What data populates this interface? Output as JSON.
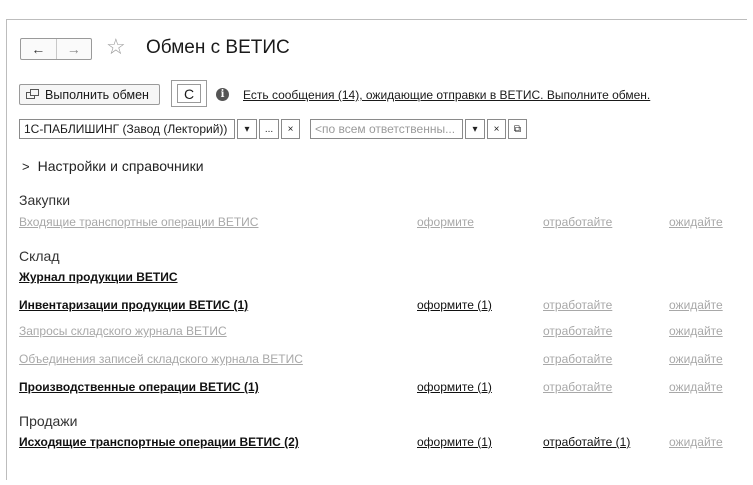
{
  "window": {
    "title": "Обмен с ВЕТИС",
    "nav_back": "←",
    "nav_forward": "→",
    "favorite_glyph": "☆"
  },
  "toolbar": {
    "exchange_label": "Выполнить обмен",
    "exchange_icon": "exchange-icon",
    "refresh_glyph": "C",
    "info_glyph": "i",
    "notice": "Есть сообщения (14), ожидающие отправки в ВЕТИС. Выполните обмен."
  },
  "filters": {
    "organization_value": "1С-ПАБЛИШИНГ (Завод (Лекторий))",
    "organization_dropdown": "▾",
    "organization_select": "...",
    "organization_clear": "×",
    "responsible_placeholder": "<по всем ответственны...",
    "responsible_dropdown": "▾",
    "responsible_clear": "×",
    "responsible_open": "⧉"
  },
  "settings": {
    "chevron": ">",
    "label": "Настройки и справочники"
  },
  "sections": {
    "purchases": {
      "title": "Закупки",
      "rows": [
        {
          "label": "Входящие транспортные операции ВЕТИС",
          "c1": "оформите",
          "c2": "отработайте",
          "c3": "ожидайте"
        }
      ]
    },
    "warehouse": {
      "title": "Склад",
      "journal": "Журнал продукции ВЕТИС",
      "rows": [
        {
          "label": "Инвентаризации продукции ВЕТИС (1)",
          "c1": "оформите (1)",
          "c2": "отработайте",
          "c3": "ожидайте"
        },
        {
          "label": "Запросы складского журнала ВЕТИС",
          "c1": "",
          "c2": "отработайте",
          "c3": "ожидайте"
        },
        {
          "label": "Объединения записей складского журнала ВЕТИС",
          "c1": "",
          "c2": "отработайте",
          "c3": "ожидайте"
        },
        {
          "label": "Производственные операции ВЕТИС (1)",
          "c1": "оформите (1)",
          "c2": "отработайте",
          "c3": "ожидайте"
        }
      ]
    },
    "sales": {
      "title": "Продажи",
      "rows": [
        {
          "label": "Исходящие транспортные операции ВЕТИС (2)",
          "c1": "оформите (1)",
          "c2": "отработайте (1)",
          "c3": "ожидайте"
        }
      ]
    }
  }
}
